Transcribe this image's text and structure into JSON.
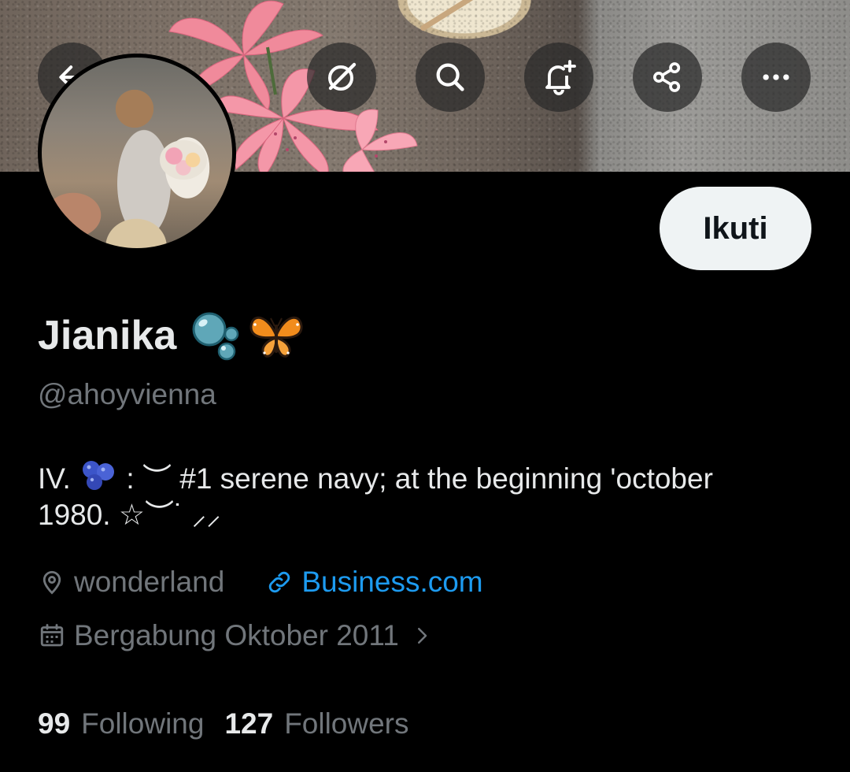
{
  "header": {
    "buttons": [
      {
        "name": "back-button",
        "icon": "arrow-left-icon"
      },
      {
        "name": "grok-button",
        "icon": "grok-icon"
      },
      {
        "name": "search-button",
        "icon": "search-icon"
      },
      {
        "name": "notify-button",
        "icon": "bell-plus-icon"
      },
      {
        "name": "share-button",
        "icon": "share-icon"
      },
      {
        "name": "more-button",
        "icon": "more-dots-icon"
      }
    ]
  },
  "profile": {
    "display_name": "Jianika",
    "name_emojis": "🫧🦋",
    "handle": "@ahoyvienna",
    "follow_label": "Ikuti",
    "bio_line1_prefix": "IV.",
    "bio_emoji": "🫐",
    "bio_line1_rest": ": ︶ #1 serene navy; at the beginning 'october",
    "bio_line2": "1980. ☆︶˙ ⸝⸝",
    "location": "wonderland",
    "website": "Business.com",
    "joined": "Bergabung Oktober 2011",
    "following_count": "99",
    "following_label": "Following",
    "followers_count": "127",
    "followers_label": "Followers"
  },
  "colors": {
    "background": "#000000",
    "primary_text": "#e7e9ea",
    "secondary_text": "#71767b",
    "link": "#1d9bf0",
    "follow_button_bg": "#eff3f4"
  }
}
